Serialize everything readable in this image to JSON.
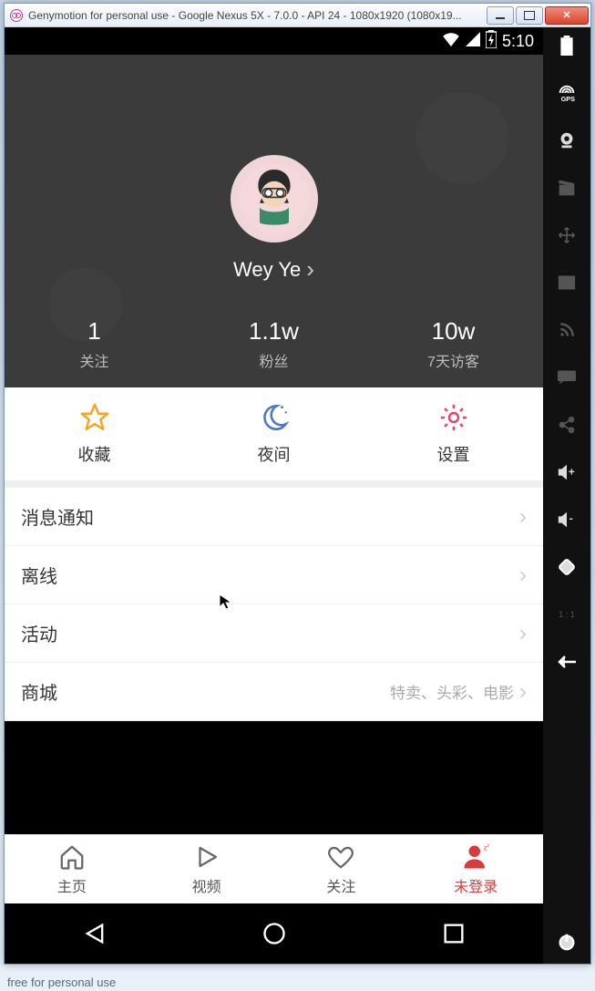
{
  "window": {
    "title": "Genymotion for personal use - Google Nexus 5X - 7.0.0 - API 24 - 1080x1920 (1080x19..."
  },
  "status": {
    "time": "5:10"
  },
  "profile": {
    "username": "Wey Ye",
    "stats": [
      {
        "value": "1",
        "label": "关注"
      },
      {
        "value": "1.1w",
        "label": "粉丝"
      },
      {
        "value": "10w",
        "label": "7天访客"
      }
    ]
  },
  "quick_actions": [
    {
      "label": "收藏",
      "icon": "star"
    },
    {
      "label": "夜间",
      "icon": "moon"
    },
    {
      "label": "设置",
      "icon": "gear"
    }
  ],
  "list": [
    {
      "title": "消息通知",
      "sub": ""
    },
    {
      "title": "离线",
      "sub": ""
    },
    {
      "title": "活动",
      "sub": ""
    },
    {
      "title": "商城",
      "sub": "特卖、头彩、电影"
    }
  ],
  "tabs": [
    {
      "label": "主页",
      "icon": "home",
      "active": false
    },
    {
      "label": "视频",
      "icon": "play",
      "active": false
    },
    {
      "label": "关注",
      "icon": "heart",
      "active": false
    },
    {
      "label": "未登录",
      "icon": "user",
      "active": true
    }
  ],
  "watermark": "free for personal use"
}
